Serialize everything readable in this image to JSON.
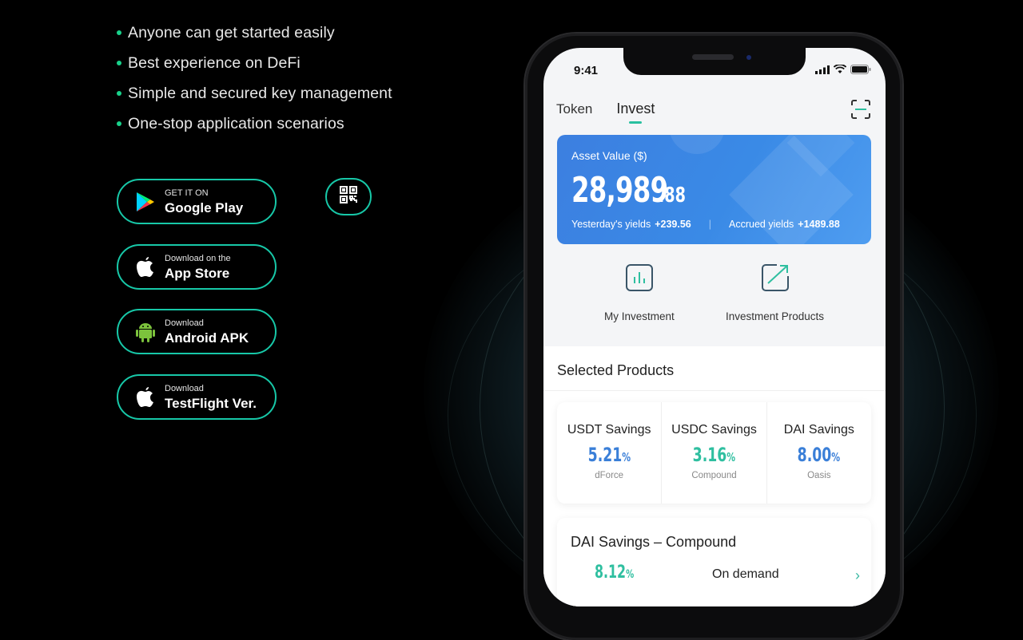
{
  "features": [
    "Anyone can get started easily",
    "Best experience on DeFi",
    "Simple and secured key management",
    "One-stop application scenarios"
  ],
  "downloads": {
    "google_play": {
      "small": "GET IT ON",
      "big": "Google Play"
    },
    "app_store": {
      "small": "Download on the",
      "big": "App Store"
    },
    "android_apk": {
      "small": "Download",
      "big": "Android APK"
    },
    "testflight": {
      "small": "Download",
      "big": "TestFlight Ver."
    }
  },
  "colors": {
    "accent": "#17c8a8",
    "card_blue": "#3a8ae6",
    "rate_blue": "#3a7fd8",
    "rate_teal": "#2fbfa0"
  },
  "phone": {
    "status_time": "9:41",
    "tabs": [
      "Token",
      "Invest"
    ],
    "active_tab": "Invest",
    "asset": {
      "label": "Asset Value  ($)",
      "value_int": "28,989",
      "value_dec": ".88",
      "yesterday_label": "Yesterday's yields",
      "yesterday_value": "+239.56",
      "accrued_label": "Accrued yields",
      "accrued_value": "+1489.88"
    },
    "quick_actions": [
      "My Investment",
      "Investment Products"
    ],
    "selected_title": "Selected Products",
    "products": [
      {
        "name": "USDT Savings",
        "rate": "5.21",
        "unit": "%",
        "source": "dForce",
        "color": "#3a7fd8"
      },
      {
        "name": "USDC Savings",
        "rate": "3.16",
        "unit": "%",
        "source": "Compound",
        "color": "#2fbfa0"
      },
      {
        "name": "DAI Savings",
        "rate": "8.00",
        "unit": "%",
        "source": "Oasis",
        "color": "#3a7fd8"
      }
    ],
    "detail": {
      "title": "DAI Savings – Compound",
      "rate": "8.12",
      "unit": "%",
      "term": "On demand",
      "chevron": "›"
    }
  }
}
